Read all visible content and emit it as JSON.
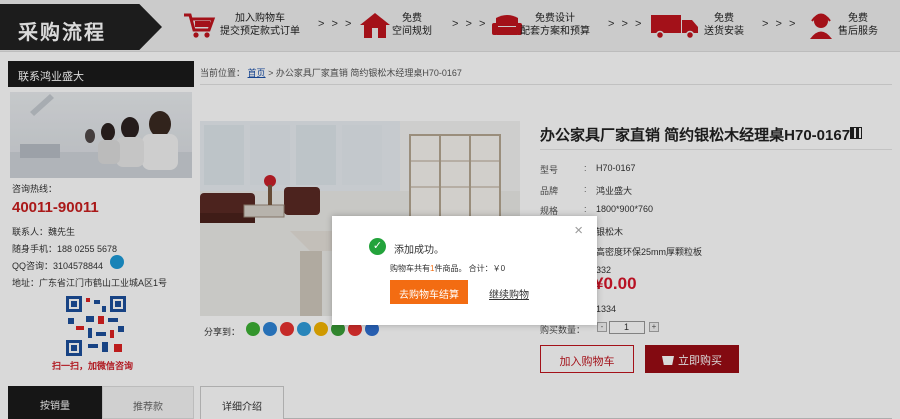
{
  "banner": {
    "title": "采购流程",
    "arrows": "> > >",
    "steps": [
      {
        "icon": "cart-icon",
        "line1": "加入购物车",
        "line2": "提交预定款式订单"
      },
      {
        "icon": "house-icon",
        "line1": "免费",
        "line2": "空间规划"
      },
      {
        "icon": "sofa-icon",
        "line1": "免费设计",
        "line2": "配套方案和预算"
      },
      {
        "icon": "truck-icon",
        "line1": "免费",
        "line2": "送货安装"
      },
      {
        "icon": "headset-icon",
        "line1": "免费",
        "line2": "售后服务"
      }
    ]
  },
  "sidebar": {
    "heading": "联系鸿业盛大",
    "hotline_label": "咨询热线：",
    "hotline": "40011-90011",
    "contact": "联系人：魏先生",
    "mobile": "随身手机：188 0255 5678",
    "qq": "QQ咨询：3104578844",
    "address": "地址：广东省江门市鹤山工业城A区1号",
    "qr_caption": "扫一扫，加微信咨询"
  },
  "tabs": {
    "best": "按销量",
    "recommend": "推荐款",
    "detail": "详细介绍"
  },
  "breadcrumb": {
    "prefix": "当前位置：",
    "home": "首页",
    "sep": ">",
    "current": "办公家具厂家直销 简约银松木经理桌H70-0167"
  },
  "product": {
    "title": "办公家具厂家直销 简约银松木经理桌H70-0167",
    "specs": [
      {
        "label": "型号",
        "value": "H70-0167"
      },
      {
        "label": "品牌",
        "value": "鸿业盛大"
      },
      {
        "label": "规格",
        "value": "1800*900*760"
      },
      {
        "label": "",
        "value": "银松木"
      },
      {
        "label": "",
        "value": "高密度环保25mm厚颗粒板"
      },
      {
        "label": "",
        "value": "332"
      }
    ],
    "price": "¥0.00",
    "stock_value": "1334",
    "qty_label": "购买数量：",
    "qty_value": "1",
    "qty_minus": "-",
    "qty_plus": "+",
    "add_cart": "加入购物车",
    "buy_now": "立即购买",
    "share_label": "分享到："
  },
  "share_icons": [
    {
      "icon": "wechat-icon",
      "color": "#3cb034"
    },
    {
      "icon": "qzone-icon",
      "color": "#2e84d6"
    },
    {
      "icon": "weibo-icon",
      "color": "#e8322f"
    },
    {
      "icon": "tencent-weibo-icon",
      "color": "#2f9ddb"
    },
    {
      "icon": "pengyou-icon",
      "color": "#f4b400"
    },
    {
      "icon": "douban-icon",
      "color": "#3a9e37"
    },
    {
      "icon": "renren-icon",
      "color": "#e8322f"
    },
    {
      "icon": "tieba-icon",
      "color": "#2e6fcf"
    }
  ],
  "modal": {
    "close": "×",
    "check": "✓",
    "message": "添加成功。",
    "summary_pre": "购物车共有",
    "summary_count": "1",
    "summary_post": "件商品。 合计：￥0",
    "checkout": "去购物车结算",
    "continue": "继续购物"
  },
  "colors": {
    "accent_red": "#c0141e",
    "dark_red": "#9a0c14",
    "orange": "#f36c12",
    "hotline": "#c81e1e",
    "success": "#23a33b"
  }
}
